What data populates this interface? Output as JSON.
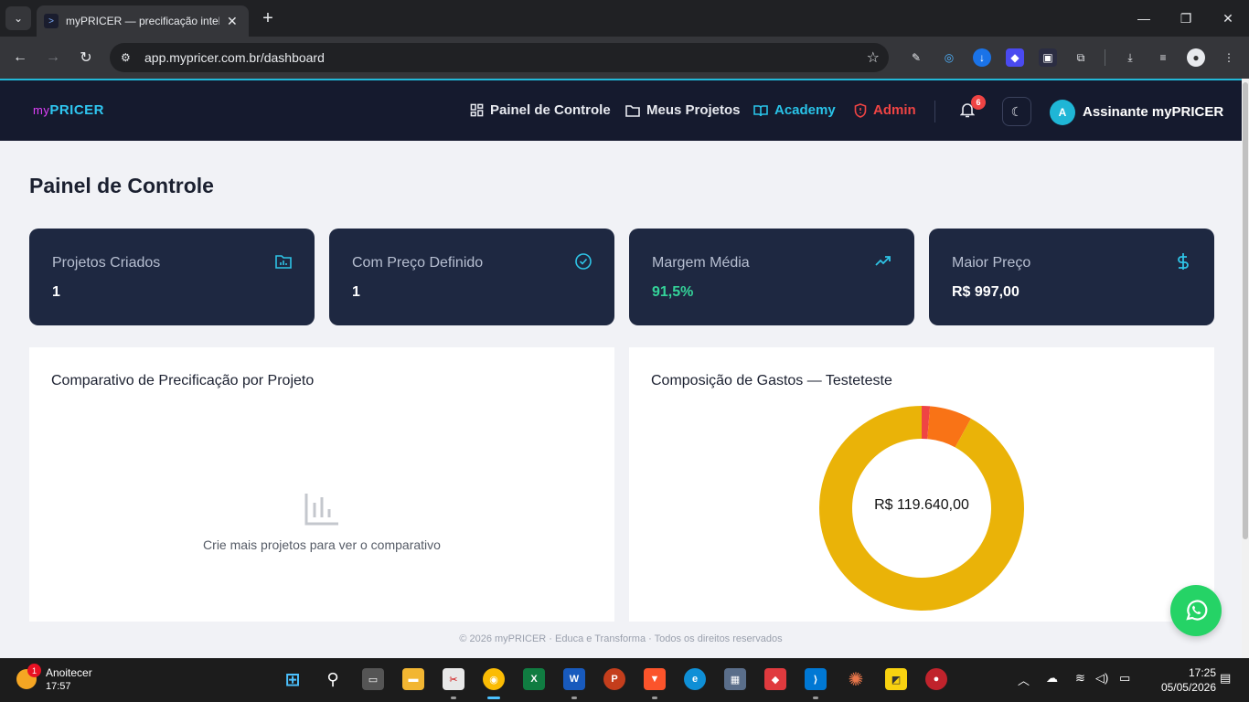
{
  "browser": {
    "tab_title": "myPRICER — precificação inteligente",
    "tab_list_icon": "chevron-down-icon",
    "new_tab_icon": "plus-icon",
    "url": "app.mypricer.com.br/dashboard"
  },
  "app": {
    "logo_my": "my",
    "logo_pricer": "PRICER",
    "nav": {
      "dashboard": "Painel de Controle",
      "projects": "Meus Projetos",
      "academy": "Academy",
      "admin": "Admin"
    },
    "notifications_count": "6",
    "user_initial": "A",
    "user_name": "Assinante myPRICER",
    "colors": {
      "navbar": "#151a2e",
      "accent": "#2fc6f0",
      "admin": "#ef4444",
      "card": "#1e2841",
      "positive": "#34d399"
    }
  },
  "page": {
    "title": "Painel de Controle",
    "stats": [
      {
        "label": "Projetos Criados",
        "value": "1",
        "icon": "folder-chart-icon"
      },
      {
        "label": "Com Preço Definido",
        "value": "1",
        "icon": "check-circle-icon"
      },
      {
        "label": "Margem Média",
        "value": "91,5%",
        "icon": "trending-up-icon"
      },
      {
        "label": "Maior Preço",
        "value": "R$ 997,00",
        "icon": "dollar-icon"
      }
    ],
    "comparison": {
      "title": "Comparativo de Precificação por Projeto",
      "empty_text": "Crie mais projetos para ver o comparativo"
    },
    "composition": {
      "title": "Composição de Gastos — Testeteste",
      "center_value": "R$ 119.640,00"
    },
    "footer": "© 2026 myPRICER · Educa e Transforma · Todos os direitos reservados"
  },
  "chart_data": {
    "type": "pie",
    "title": "Composição de Gastos — Testeteste",
    "series": [
      {
        "value": 1.3,
        "color": "#ef4444"
      },
      {
        "value": 6.7,
        "color": "#f97316"
      },
      {
        "value": 92.0,
        "color": "#eab308"
      }
    ]
  },
  "taskbar": {
    "weather_title": "Anoitecer",
    "weather_time": "17:57",
    "weather_badge": "1",
    "clock_time": "17:25",
    "clock_date": "05/05/2026"
  }
}
